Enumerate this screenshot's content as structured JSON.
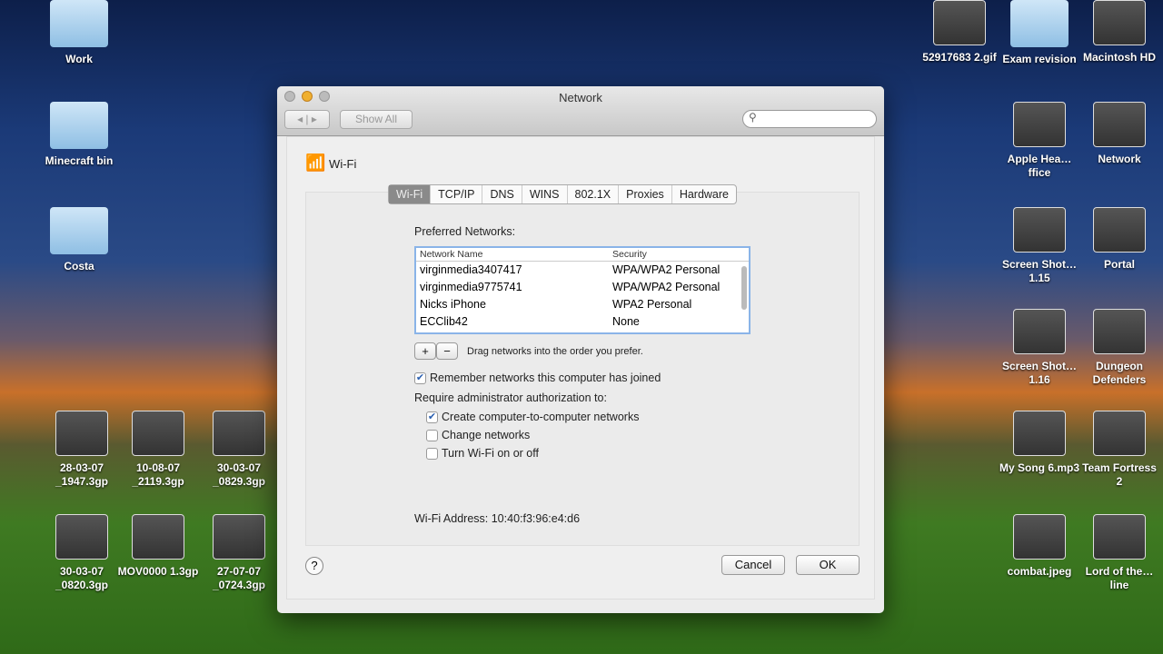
{
  "desktop": {
    "left": [
      {
        "label": "Work",
        "kind": "folder"
      },
      {
        "label": "Minecraft bin",
        "kind": "folder"
      },
      {
        "label": "Costa",
        "kind": "folder"
      }
    ],
    "videos": [
      "28-03-07 _1947.3gp",
      "10-08-07 _2119.3gp",
      "30-03-07 _0829.3gp",
      "30-03-07 _0820.3gp",
      "MOV0000 1.3gp",
      "27-07-07 _0724.3gp"
    ],
    "right": [
      "52917683 2.gif",
      "Exam revision",
      "Macintosh HD",
      "Apple Hea…ffice",
      "Network",
      "Screen Shot…1.15",
      "Portal",
      "Screen Shot…1.16",
      "Dungeon Defenders",
      "My Song 6.mp3",
      "Team Fortress 2",
      "combat.jpeg",
      "Lord of the…line"
    ]
  },
  "window": {
    "title": "Network",
    "show_all": "Show All",
    "search_placeholder": "",
    "service": "Wi-Fi",
    "tabs": [
      "Wi-Fi",
      "TCP/IP",
      "DNS",
      "WINS",
      "802.1X",
      "Proxies",
      "Hardware"
    ],
    "preferred_label": "Preferred Networks:",
    "columns": [
      "Network Name",
      "Security"
    ],
    "networks": [
      [
        "virginmedia3407417",
        "WPA/WPA2 Personal"
      ],
      [
        "virginmedia9775741",
        "WPA/WPA2 Personal"
      ],
      [
        "Nicks iPhone",
        "WPA2 Personal"
      ],
      [
        "ECClib42",
        "None"
      ]
    ],
    "add": "+",
    "remove": "−",
    "drag_hint": "Drag networks into the order you prefer.",
    "remember": "Remember networks this computer has joined",
    "require_label": "Require administrator authorization to:",
    "opt_create": "Create computer-to-computer networks",
    "opt_change": "Change networks",
    "opt_toggle": "Turn Wi-Fi on or off",
    "address": "Wi-Fi Address: 10:40:f3:96:e4:d6",
    "help": "?",
    "cancel": "Cancel",
    "ok": "OK"
  }
}
